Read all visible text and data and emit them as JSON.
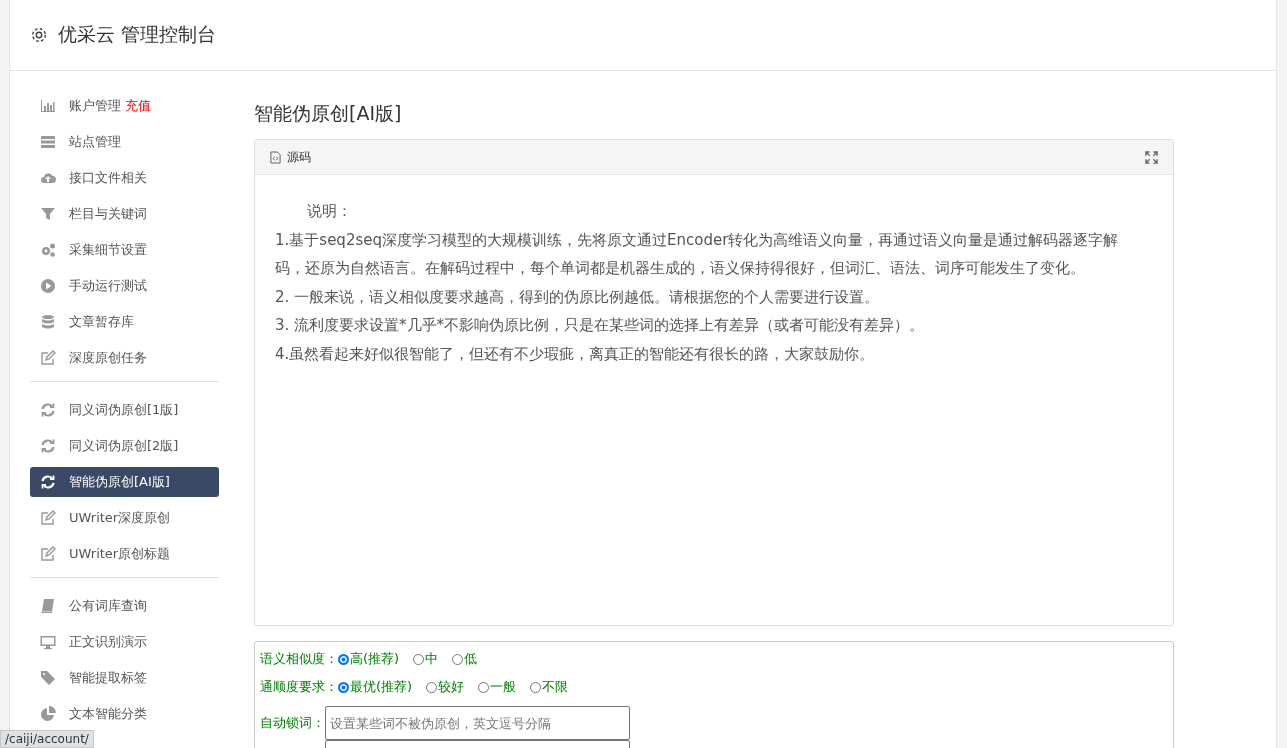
{
  "header": {
    "title": "优采云 管理控制台"
  },
  "sidebar": {
    "groups": [
      {
        "items": [
          {
            "label": "账户管理",
            "badge": "充值",
            "selected": false
          },
          {
            "label": "站点管理",
            "selected": false
          },
          {
            "label": "接口文件相关",
            "selected": false
          },
          {
            "label": "栏目与关键词",
            "selected": false
          },
          {
            "label": "采集细节设置",
            "selected": false
          },
          {
            "label": "手动运行测试",
            "selected": false
          },
          {
            "label": "文章暂存库",
            "selected": false
          },
          {
            "label": "深度原创任务",
            "selected": false
          }
        ]
      },
      {
        "items": [
          {
            "label": "同义词伪原创[1版]",
            "selected": false
          },
          {
            "label": "同义词伪原创[2版]",
            "selected": false
          },
          {
            "label": "智能伪原创[AI版]",
            "selected": true
          },
          {
            "label": "UWriter深度原创",
            "selected": false
          },
          {
            "label": "UWriter原创标题",
            "selected": false
          }
        ]
      },
      {
        "items": [
          {
            "label": "公有词库查询",
            "selected": false
          },
          {
            "label": "正文识别演示",
            "selected": false
          },
          {
            "label": "智能提取标签",
            "selected": false
          },
          {
            "label": "文本智能分类",
            "selected": false
          }
        ]
      }
    ]
  },
  "page_title": "智能伪原创[AI版]",
  "editor": {
    "tab": "源码",
    "paragraphs": [
      "说明：",
      "1.基于seq2seq深度学习模型的大规模训练，先将原文通过Encoder转化为高维语义向量，再通过语义向量是通过解码器逐字解码，还原为自然语言。在解码过程中，每个单词都是机器生成的，语义保持得很好，但词汇、语法、词序可能发生了变化。",
      "2. 一般来说，语义相似度要求越高，得到的伪原比例越低。请根据您的个人需要进行设置。",
      "3. 流利度要求设置*几乎*不影响伪原比例，只是在某些词的选择上有差异（或者可能没有差异）。",
      "4.虽然看起来好似很智能了，但还有不少瑕疵，离真正的智能还有很长的路，大家鼓励你。"
    ]
  },
  "form": {
    "radio_groups": [
      {
        "label": "语义相似度：",
        "options": [
          {
            "label": "高(推荐)",
            "selected": true
          },
          {
            "label": "中",
            "selected": false
          },
          {
            "label": "低",
            "selected": false
          }
        ]
      },
      {
        "label": "通顺度要求：",
        "options": [
          {
            "label": "最优(推荐)",
            "selected": true
          },
          {
            "label": "较好",
            "selected": false
          },
          {
            "label": "一般",
            "selected": false
          },
          {
            "label": "不限",
            "selected": false
          }
        ]
      }
    ],
    "lock_words": {
      "label": "自动锁词：",
      "placeholder": "设置某些词不被伪原创，英文逗号分隔"
    }
  },
  "status_url": "/caiji/account/"
}
